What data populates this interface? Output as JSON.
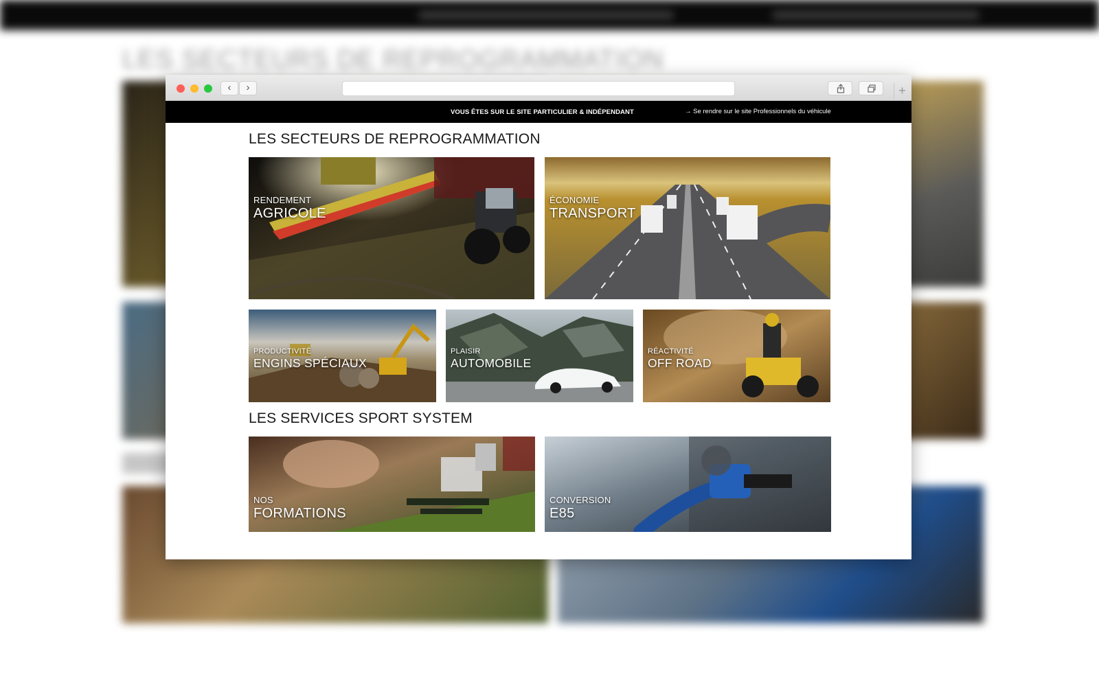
{
  "colors": {
    "site_bar": "#000000",
    "title_text": "#1a1a1a",
    "caption_text": "#ffffff",
    "traffic_red": "#fc5f57",
    "traffic_yellow": "#fdbb2e",
    "traffic_green": "#2ac840"
  },
  "background": {
    "title": "LES SECTEURS DE REPROGRAMMATION"
  },
  "browser": {
    "back_icon": "chevron-left-icon",
    "forward_icon": "chevron-right-icon",
    "share_icon": "share-icon",
    "tabs_icon": "tabs-icon",
    "new_tab_icon": "plus-icon",
    "back_glyph": "‹",
    "forward_glyph": "›",
    "new_tab_glyph": "+"
  },
  "site_bar": {
    "message": "VOUS ÊTES SUR LE SITE PARTICULIER & INDÉPENDANT",
    "pro_link": "→ Se rendre sur le site Professionnels du véhicule"
  },
  "sectors": {
    "title": "LES SECTEURS DE REPROGRAMMATION",
    "tiles": [
      {
        "kicker": "RENDEMENT",
        "name": "AGRICOLE"
      },
      {
        "kicker": "ÉCONOMIE",
        "name": "TRANSPORT"
      },
      {
        "kicker": "PRODUCTIVITÉ",
        "name": "ENGINS SPÉCIAUX"
      },
      {
        "kicker": "PLAISIR",
        "name": "AUTOMOBILE"
      },
      {
        "kicker": "RÉACTIVITÉ",
        "name": "OFF ROAD"
      }
    ]
  },
  "services": {
    "title": "LES SERVICES SPORT SYSTEM",
    "tiles": [
      {
        "kicker": "NOS",
        "name": "FORMATIONS"
      },
      {
        "kicker": "CONVERSION",
        "name": "E85"
      }
    ]
  }
}
